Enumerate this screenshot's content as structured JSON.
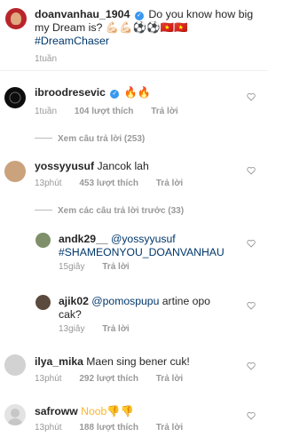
{
  "caption": {
    "username": "doanvanhau_1904",
    "text": "Do you know how big my Dream is? 💪🏻💪🏻⚽⚽🇻🇳🇻🇳",
    "hashtag": "#DreamChaser",
    "time": "1tuần"
  },
  "comments": [
    {
      "username": "ibroodresevic",
      "text": "🔥🔥",
      "time": "1tuần",
      "likes": "104 lượt thích",
      "reply": "Trả lời",
      "view_replies": "Xem câu trả lời (253)"
    },
    {
      "username": "yossyyusuf",
      "text": "Jancok lah",
      "time": "13phút",
      "likes": "453 lượt thích",
      "reply": "Trả lời",
      "view_replies": "Xem các câu trả lời trước (33)"
    }
  ],
  "replies": [
    {
      "username": "andk29__",
      "mention": "@yossyyusuf",
      "text": "#SHAMEONYOU_DOANVANHAU",
      "time": "15giây",
      "reply": "Trả lời"
    },
    {
      "username": "ajik02",
      "mention": "@pomospupu",
      "text": "artine opo cak?",
      "time": "13giây",
      "reply": "Trả lời"
    }
  ],
  "comments2": [
    {
      "username": "ilya_mika",
      "text": "Maen sing bener cuk!",
      "time": "13phút",
      "likes": "292 lượt thích",
      "reply": "Trả lời"
    },
    {
      "username": "safroww",
      "text": "Noob👎👎",
      "time": "13phút",
      "likes": "188 lượt thích",
      "reply": "Trả lời"
    }
  ]
}
